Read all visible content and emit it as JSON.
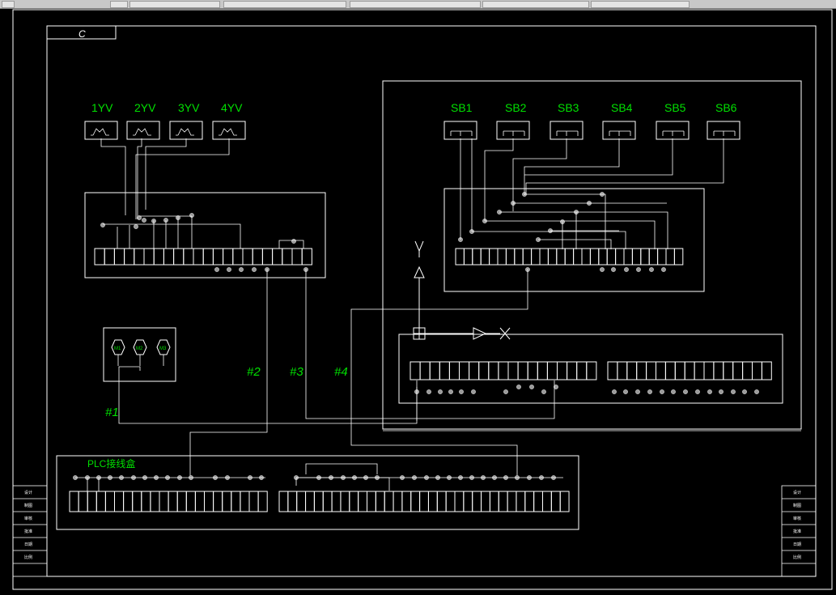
{
  "toolbar": {
    "segments": 7
  },
  "title_box": {
    "text": "C"
  },
  "valves": {
    "labels": [
      "1YV",
      "2YV",
      "3YV",
      "4YV"
    ]
  },
  "buttons": {
    "labels": [
      "SB1",
      "SB2",
      "SB3",
      "SB4",
      "SB5",
      "SB6"
    ]
  },
  "motors": {
    "labels": [
      "M1",
      "M2",
      "M3"
    ]
  },
  "wires": {
    "w1": "#1",
    "w2": "#2",
    "w3": "#3",
    "w4": "#4"
  },
  "plc": {
    "label": "PLC接线盒"
  },
  "symbols": {
    "antenna": "Y",
    "cross": "X"
  },
  "title_block": {
    "rows": [
      "设计",
      "制图",
      "审核",
      "批准",
      "日期",
      "比例"
    ]
  },
  "colors": {
    "background": "#000000",
    "line": "#ffffff",
    "label": "#00e000",
    "node": "#999999"
  }
}
